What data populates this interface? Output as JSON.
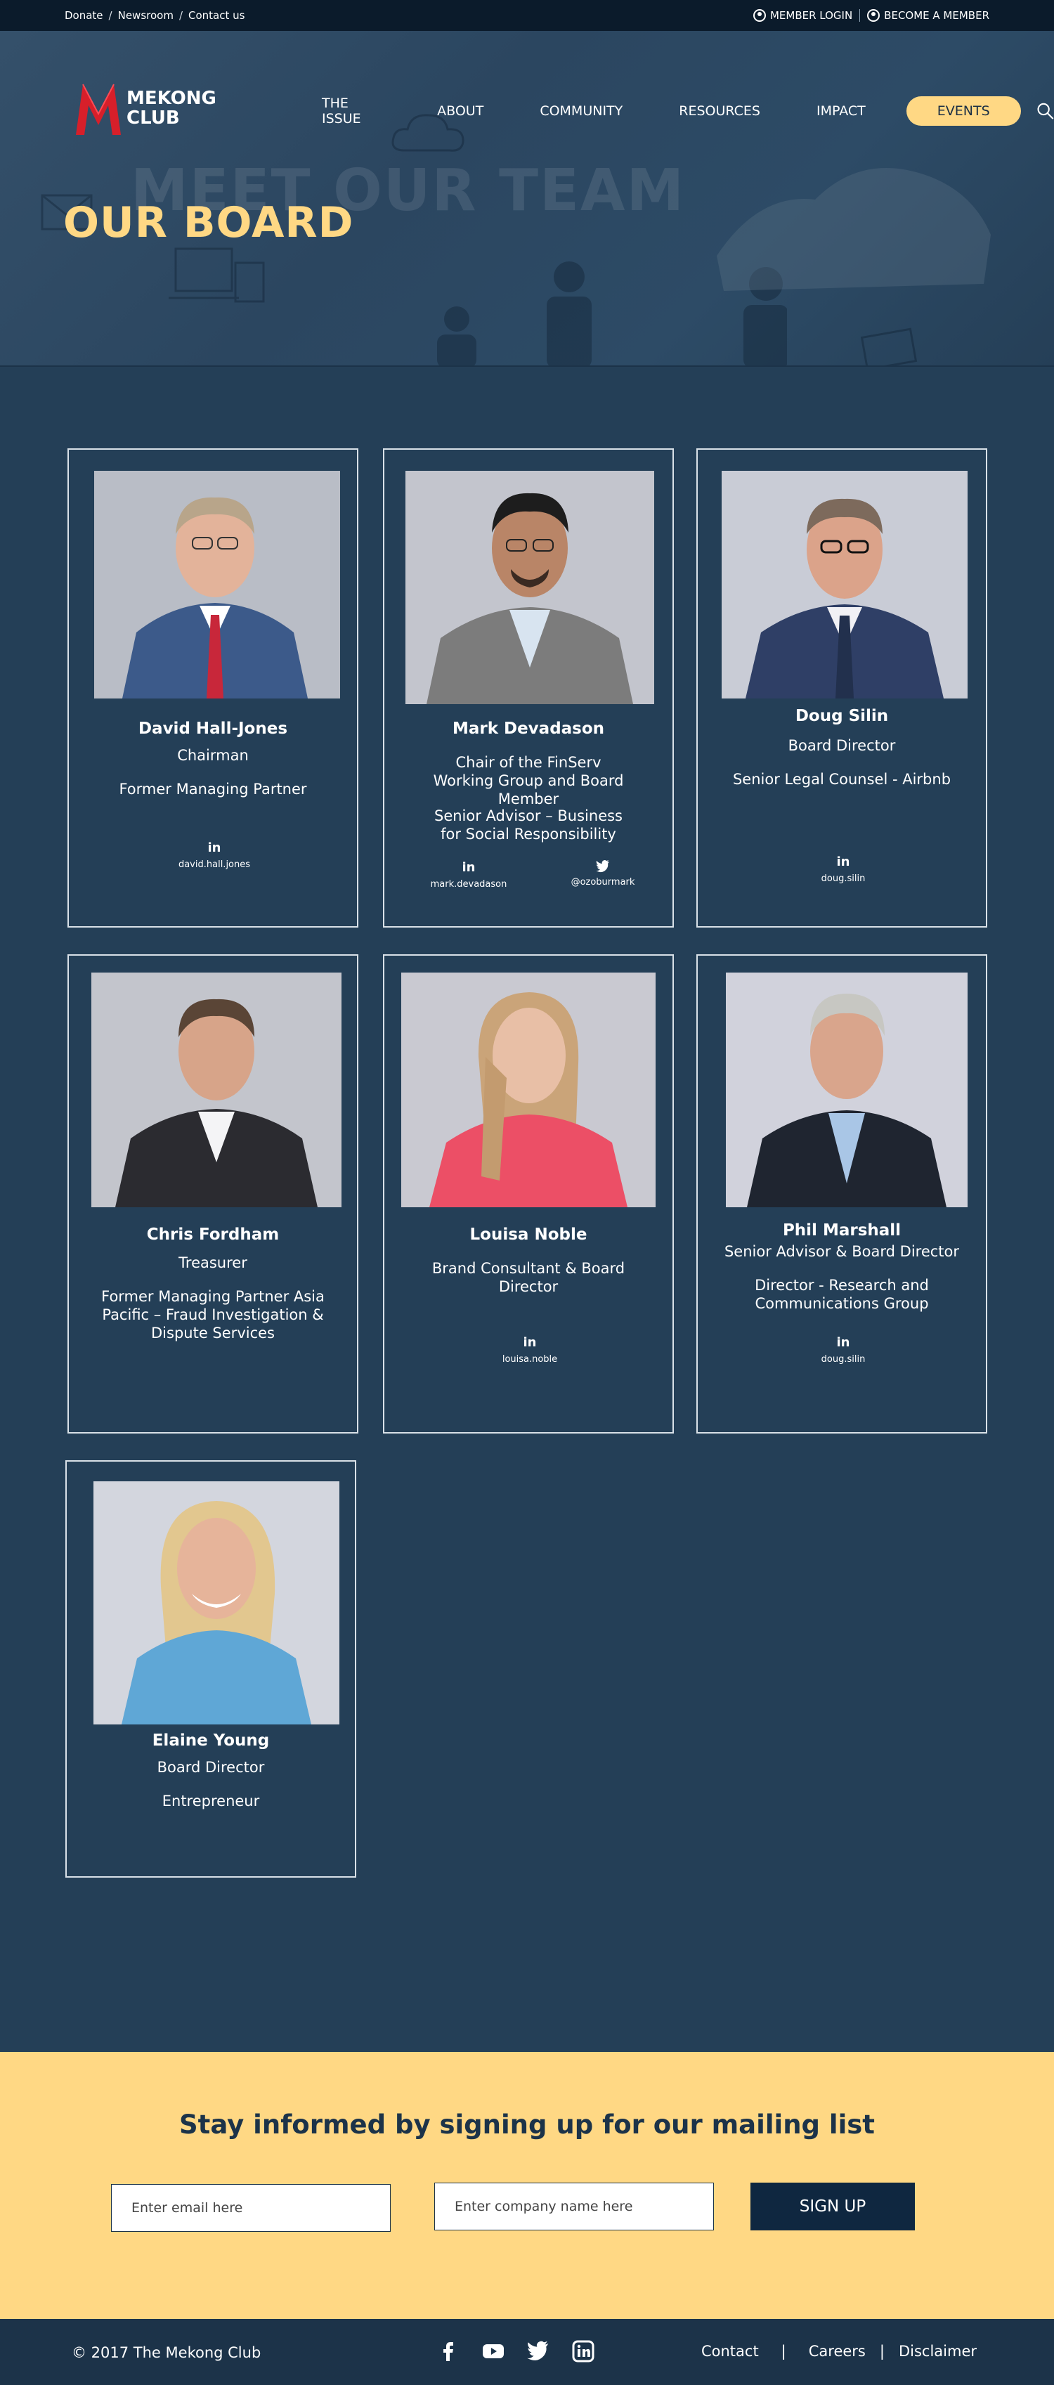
{
  "topbar": {
    "links": [
      "Donate",
      "Newsroom",
      "Contact us"
    ],
    "member_login": "MEMBER  LOGIN",
    "become_member": "BECOME A MEMBER"
  },
  "logo": {
    "line1": "MEKONG",
    "line2": "CLUB"
  },
  "nav": {
    "items": [
      "THE ISSUE",
      "ABOUT",
      "COMMUNITY",
      "RESOURCES",
      "IMPACT"
    ],
    "events": "EVENTS"
  },
  "hero": {
    "background_text": "MEET OUR TEAM",
    "title": "OUR BOARD"
  },
  "board": [
    {
      "name": "David Hall-Jones",
      "role": "Chairman",
      "details": [
        "Former Managing Partner"
      ],
      "linkedin": "david.hall.jones"
    },
    {
      "name": "Mark Devadason",
      "role": "Chair of the FinServ Working Group and Board Member",
      "details": [
        "Senior Advisor – Business for Social Responsibility"
      ],
      "linkedin": "mark.devadason",
      "twitter": "@ozoburmark"
    },
    {
      "name": "Doug Silin",
      "role": "Board Director",
      "details": [
        "Senior Legal Counsel - Airbnb"
      ],
      "linkedin": "doug.silin"
    },
    {
      "name": "Chris Fordham",
      "role": "Treasurer",
      "details": [
        "Former Managing Partner Asia Pacific – Fraud Investigation & Dispute Services"
      ]
    },
    {
      "name": "Louisa Noble",
      "role": "Brand Consultant & Board Director",
      "details": [],
      "linkedin": "louisa.noble"
    },
    {
      "name": "Phil Marshall",
      "role": "Senior Advisor & Board Director",
      "details": [
        "Director - Research and Communications Group"
      ],
      "linkedin": "doug.silin"
    },
    {
      "name": "Elaine Young",
      "role": "Board Director",
      "details": [
        "Entrepreneur"
      ]
    }
  ],
  "signup": {
    "heading": "Stay informed by signing up for our mailing list",
    "email_placeholder": "Enter email here",
    "company_placeholder": "Enter  company name here",
    "button": "SIGN UP"
  },
  "footer": {
    "copyright": "© 2017 The Mekong Club",
    "links": [
      "Contact",
      "Careers",
      "Disclaimer"
    ]
  },
  "colors": {
    "page_bg": "#243f57",
    "accent_yellow": "#ffd884",
    "topbar_bg": "#0b1b2b",
    "button_dark": "#0f2740",
    "logo_red": "#d71f2a"
  }
}
